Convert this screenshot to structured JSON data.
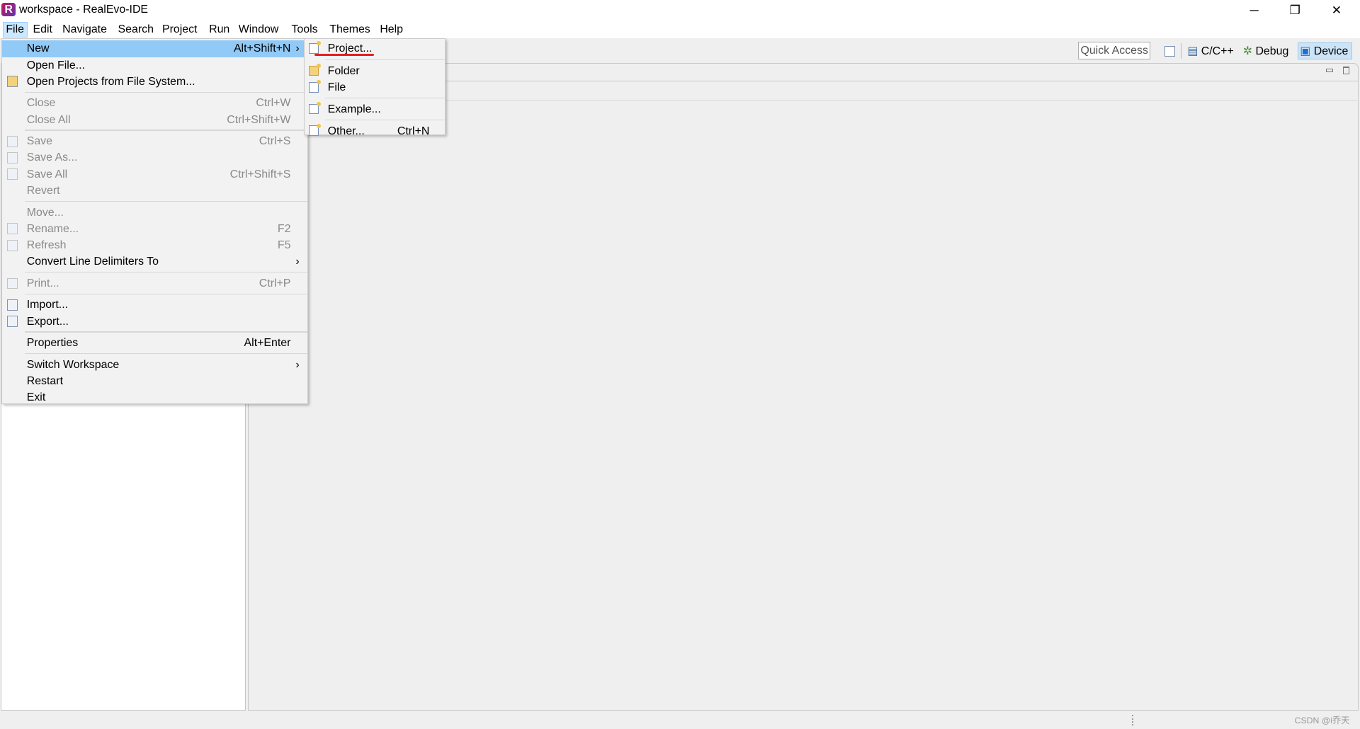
{
  "window": {
    "title": "workspace - RealEvo-IDE",
    "logo_letter": "R",
    "minimize": "─",
    "restore": "❐",
    "close": "✕"
  },
  "menubar": [
    "File",
    "Edit",
    "Navigate",
    "Search",
    "Project",
    "Run",
    "Window",
    "Tools",
    "Themes",
    "Help"
  ],
  "toolbar": {
    "quick_access": "Quick Access",
    "perspectives": [
      {
        "label": "C/C++",
        "icon": "cpp-perspective-icon"
      },
      {
        "label": "Debug",
        "icon": "bug-icon"
      },
      {
        "label": "Device",
        "icon": "monitor-icon",
        "active": true
      }
    ]
  },
  "file_menu": [
    {
      "label": "New",
      "shortcut": "Alt+Shift+N",
      "submenu": true,
      "highlighted": true
    },
    {
      "label": "Open File..."
    },
    {
      "label": "Open Projects from File System...",
      "icon": "folder-icon"
    },
    {
      "sep": true
    },
    {
      "label": "Close",
      "shortcut": "Ctrl+W",
      "disabled": true
    },
    {
      "label": "Close All",
      "shortcut": "Ctrl+Shift+W",
      "disabled": true
    },
    {
      "sep": true
    },
    {
      "label": "Save",
      "shortcut": "Ctrl+S",
      "disabled": true,
      "icon": "save-icon"
    },
    {
      "label": "Save As...",
      "disabled": true,
      "icon": "save-as-icon"
    },
    {
      "label": "Save All",
      "shortcut": "Ctrl+Shift+S",
      "disabled": true,
      "icon": "save-all-icon"
    },
    {
      "label": "Revert",
      "disabled": true
    },
    {
      "sep": true
    },
    {
      "label": "Move...",
      "disabled": true
    },
    {
      "label": "Rename...",
      "shortcut": "F2",
      "disabled": true,
      "icon": "rename-icon"
    },
    {
      "label": "Refresh",
      "shortcut": "F5",
      "disabled": true,
      "icon": "refresh-icon"
    },
    {
      "label": "Convert Line Delimiters To",
      "submenu": true
    },
    {
      "sep": true
    },
    {
      "label": "Print...",
      "shortcut": "Ctrl+P",
      "disabled": true,
      "icon": "print-icon"
    },
    {
      "sep": true
    },
    {
      "label": "Import...",
      "icon": "import-icon"
    },
    {
      "label": "Export...",
      "icon": "export-icon"
    },
    {
      "sep": true
    },
    {
      "label": "Properties",
      "shortcut": "Alt+Enter"
    },
    {
      "sep": true
    },
    {
      "label": "Switch Workspace",
      "submenu": true
    },
    {
      "label": "Restart"
    },
    {
      "label": "Exit"
    }
  ],
  "new_submenu": [
    {
      "label": "Project...",
      "annotated": true
    },
    {
      "sep": true
    },
    {
      "label": "Folder"
    },
    {
      "label": "File"
    },
    {
      "sep": true
    },
    {
      "label": "Example..."
    },
    {
      "sep": true
    },
    {
      "label": "Other...",
      "shortcut": "Ctrl+N"
    }
  ],
  "colors": {
    "highlight": "#91c9f7",
    "annotation": "#e02020",
    "logo": "#8b1a6b"
  },
  "watermark": "CSDN @i乔天"
}
